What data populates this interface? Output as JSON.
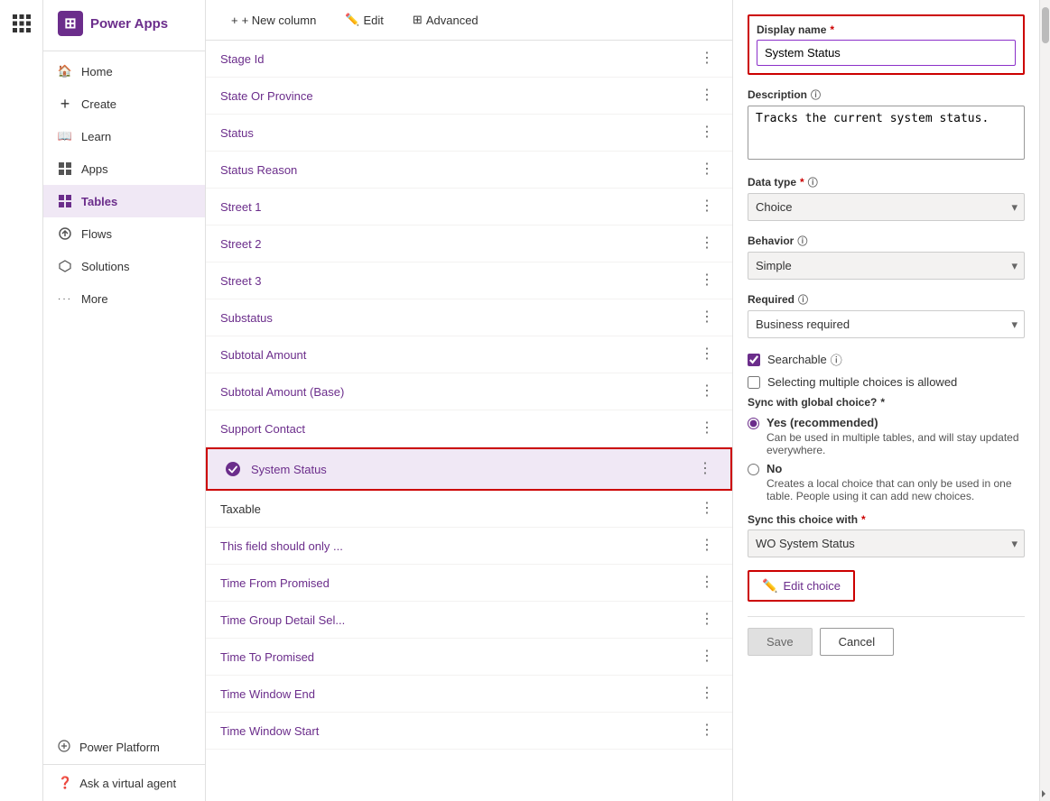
{
  "app": {
    "title": "Power Apps"
  },
  "left_nav": {
    "grid_icon": "⊞"
  },
  "sidebar": {
    "header": "Power Apps",
    "items": [
      {
        "id": "home",
        "label": "Home",
        "icon": "🏠"
      },
      {
        "id": "create",
        "label": "Create",
        "icon": "+"
      },
      {
        "id": "learn",
        "label": "Learn",
        "icon": "📖"
      },
      {
        "id": "apps",
        "label": "Apps",
        "icon": "⊞"
      },
      {
        "id": "tables",
        "label": "Tables",
        "icon": "⊞",
        "active": true
      },
      {
        "id": "flows",
        "label": "Flows",
        "icon": "↻"
      },
      {
        "id": "solutions",
        "label": "Solutions",
        "icon": "⬡"
      },
      {
        "id": "more",
        "label": "More",
        "icon": "···"
      }
    ],
    "power_platform": "Power Platform",
    "ask_agent": "Ask a virtual agent"
  },
  "toolbar": {
    "new_column": "+ New column",
    "edit": "Edit",
    "advanced": "Advanced"
  },
  "list": {
    "items": [
      {
        "id": "stage-id",
        "label": "Stage Id",
        "selected": false,
        "linkColor": true
      },
      {
        "id": "state-or-province",
        "label": "State Or Province",
        "selected": false,
        "linkColor": true
      },
      {
        "id": "status",
        "label": "Status",
        "selected": false,
        "linkColor": true
      },
      {
        "id": "status-reason",
        "label": "Status Reason",
        "selected": false,
        "linkColor": true
      },
      {
        "id": "street-1",
        "label": "Street 1",
        "selected": false,
        "linkColor": true
      },
      {
        "id": "street-2",
        "label": "Street 2",
        "selected": false,
        "linkColor": true
      },
      {
        "id": "street-3",
        "label": "Street 3",
        "selected": false,
        "linkColor": true
      },
      {
        "id": "substatus",
        "label": "Substatus",
        "selected": false,
        "linkColor": true
      },
      {
        "id": "subtotal-amount",
        "label": "Subtotal Amount",
        "selected": false,
        "linkColor": true
      },
      {
        "id": "subtotal-amount-base",
        "label": "Subtotal Amount (Base)",
        "selected": false,
        "linkColor": true
      },
      {
        "id": "support-contact",
        "label": "Support Contact",
        "selected": false,
        "linkColor": true
      },
      {
        "id": "system-status",
        "label": "System Status",
        "selected": true,
        "linkColor": true,
        "hasIcon": true
      },
      {
        "id": "taxable",
        "label": "Taxable",
        "selected": false,
        "linkColor": false
      },
      {
        "id": "this-field",
        "label": "This field should only ...",
        "selected": false,
        "linkColor": true
      },
      {
        "id": "time-from-promised",
        "label": "Time From Promised",
        "selected": false,
        "linkColor": true
      },
      {
        "id": "time-group-detail",
        "label": "Time Group Detail Sel...",
        "selected": false,
        "linkColor": true
      },
      {
        "id": "time-to-promised",
        "label": "Time To Promised",
        "selected": false,
        "linkColor": true
      },
      {
        "id": "time-window-end",
        "label": "Time Window End",
        "selected": false,
        "linkColor": true
      },
      {
        "id": "time-window-start",
        "label": "Time Window Start",
        "selected": false,
        "linkColor": true
      }
    ]
  },
  "panel": {
    "display_name_label": "Display name",
    "display_name_required": "*",
    "display_name_value": "System Status",
    "description_label": "Description",
    "description_value": "Tracks the current system status.",
    "data_type_label": "Data type",
    "data_type_required": "*",
    "data_type_value": "Choice",
    "behavior_label": "Behavior",
    "behavior_value": "Simple",
    "required_label": "Required",
    "required_value": "Business required",
    "searchable_label": "Searchable",
    "multiple_choices_label": "Selecting multiple choices is allowed",
    "sync_global_label": "Sync with global choice?",
    "sync_global_required": "*",
    "yes_label": "Yes (recommended)",
    "yes_desc": "Can be used in multiple tables, and will stay updated everywhere.",
    "no_label": "No",
    "no_desc": "Creates a local choice that can only be used in one table. People using it can add new choices.",
    "sync_choice_label": "Sync this choice with",
    "sync_choice_required": "*",
    "sync_choice_value": "WO System Status",
    "edit_choice_label": "Edit choice",
    "save_label": "Save",
    "cancel_label": "Cancel"
  }
}
